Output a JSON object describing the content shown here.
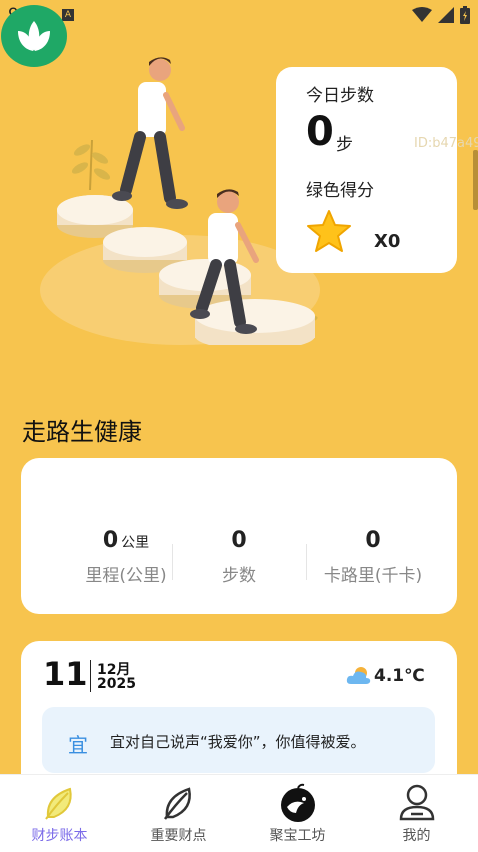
{
  "status_bar": {
    "time": "9:14",
    "badge": "A"
  },
  "step_card": {
    "today_steps_label": "今日步数",
    "steps_value": "0",
    "steps_unit": "步",
    "green_score_label": "绿色得分",
    "score_value": "X0"
  },
  "watermark_id": "ID:b47a49",
  "section_title": "走路生健康",
  "stats": {
    "distance_value": "0",
    "distance_unit": "公里",
    "distance_label": "里程(公里)",
    "steps_value": "0",
    "steps_label": "步数",
    "calories_value": "0",
    "calories_label": "卡路里(千卡)"
  },
  "calendar": {
    "day": "11",
    "month": "12月",
    "year": "2025",
    "temperature": "4.1℃",
    "weather_icon": "cloudy-icon",
    "yi_char": "宜",
    "advice": "宜对自己说声“我爱你”，你值得被爱。"
  },
  "nav": [
    {
      "label": "财步账本",
      "icon": "leaf-icon",
      "active": true
    },
    {
      "label": "重要财点",
      "icon": "leaf-outline-icon",
      "active": false
    },
    {
      "label": "聚宝工坊",
      "icon": "bird-logo-icon",
      "active": false
    },
    {
      "label": "我的",
      "icon": "user-icon",
      "active": false
    }
  ],
  "colors": {
    "background": "#F7C44E",
    "nav_active": "#7B6BE8",
    "yi_color": "#3A8FE0",
    "logo_green": "#1FA866"
  }
}
